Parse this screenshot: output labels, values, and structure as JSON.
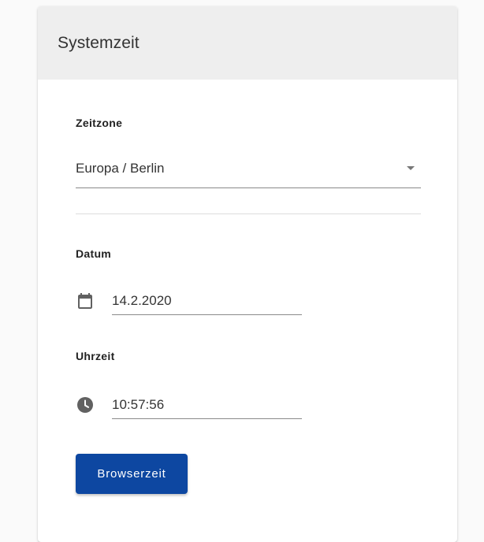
{
  "card": {
    "title": "Systemzeit"
  },
  "timezone": {
    "label": "Zeitzone",
    "value": "Europa / Berlin"
  },
  "date": {
    "label": "Datum",
    "value": "14.2.2020",
    "icon": "calendar-icon"
  },
  "time": {
    "label": "Uhrzeit",
    "value": "10:57:56",
    "icon": "clock-icon"
  },
  "actions": {
    "browser_time_label": "Browserzeit"
  },
  "colors": {
    "header_bg": "#eeeeee",
    "button_bg": "#0d47a1",
    "icon": "#616161"
  }
}
